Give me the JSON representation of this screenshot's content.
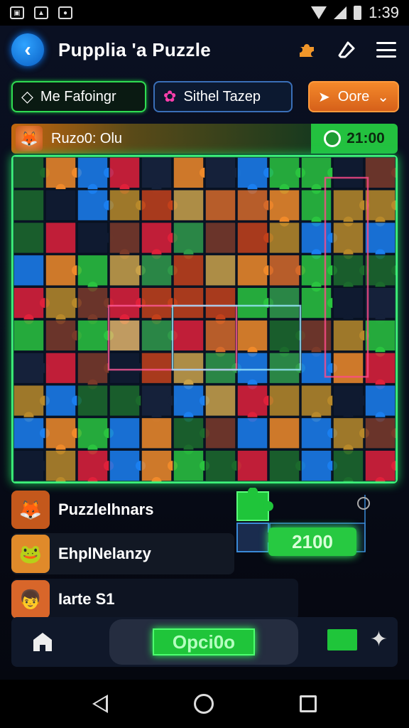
{
  "status_bar": {
    "time": "1:39",
    "left_icons": [
      "gallery-icon",
      "image-icon",
      "camera-icon"
    ],
    "right_icons": [
      "wifi-icon",
      "signal-icon",
      "battery-icon"
    ]
  },
  "header": {
    "title": "Pupplia 'a Puzzle",
    "back_icon": "chevron-left-icon",
    "icons": [
      "puzzle-piece-icon",
      "eraser-icon",
      "menu-icon"
    ]
  },
  "chips": [
    {
      "label": "Me Fafoingr",
      "icon": "arrow-tag-icon"
    },
    {
      "label": "Sithel Tazep",
      "icon": "gear-flower-icon"
    },
    {
      "label": "Oore",
      "icon": "arrow-right-icon",
      "dropdown": "⌄"
    }
  ],
  "info_bar": {
    "label": "Ruzo0: Olu",
    "timer": "21:00",
    "timer_icon": "clock-icon"
  },
  "players": [
    {
      "name": "Puzzlelhnars",
      "avatar": "fox-avatar"
    },
    {
      "name": "EhplNelanzy",
      "avatar": "frog-avatar"
    },
    {
      "name": "Iarte S1",
      "avatar": "kid-avatar"
    }
  ],
  "score": {
    "value": "2100"
  },
  "bottom_bar": {
    "center_label": "Opci0o",
    "icons": [
      "home-icon",
      "puzzle-piece-icon",
      "sparkle-icon"
    ]
  },
  "colors": {
    "accent_green": "#27c941",
    "accent_orange": "#f08a2a",
    "accent_blue": "#1a7ff0",
    "accent_red": "#e0203a",
    "background": "#070b18"
  }
}
